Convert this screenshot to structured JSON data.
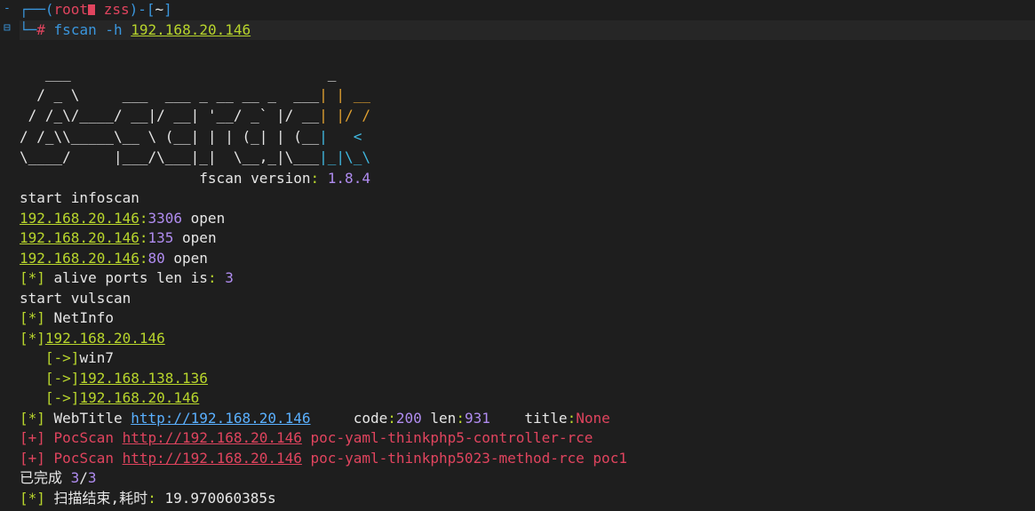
{
  "prompt": {
    "line1_prefix": "┌──(",
    "user": "root",
    "host": "zss",
    "mid": ")-[",
    "cwd": "~",
    "end": "]",
    "line2_prefix": "└─",
    "hash": "#",
    "cmd": "fscan",
    "flag": "-h",
    "target": "192.168.20.146"
  },
  "banner": {
    "l1": "   ___                              _",
    "l2a": "  / _ \\     ___  ___ _ __ __ _  ___",
    "l2b": "| | __",
    "l3a": " / /_\\/____/ __|/ __| '__/ _` |/ __",
    "l3b": "| |/ /",
    "l4a": "/ /_\\\\_____\\__ \\ (__| | | (_| | (__",
    "l4b": "|   <",
    "l5a": "\\____/     |___/\\___|_|  \\__,_|\\___",
    "l5b": "|_|\\_\\",
    "version_label": "                     fscan version",
    "version_colon": ":",
    "version": " 1.8.4"
  },
  "scan": {
    "start_info": "start infoscan",
    "ports": [
      {
        "ip": "192.168.20.146",
        "port": "3306",
        "state": " open"
      },
      {
        "ip": "192.168.20.146",
        "port": "135",
        "state": " open"
      },
      {
        "ip": "192.168.20.146",
        "port": "80",
        "state": " open"
      }
    ],
    "star": "[*]",
    "plus": "[+]",
    "arrow": "   [->]",
    "alive_text": " alive ports len is",
    "alive_colon": ":",
    "alive_count": " 3",
    "start_vul": "start vulscan",
    "netinfo": " NetInfo",
    "net_host": "192.168.20.146",
    "net_name": "win7",
    "net_ip1": "192.168.138.136",
    "net_ip2": "192.168.20.146",
    "webtitle_label": " WebTitle ",
    "webtitle_url": "http://192.168.20.146",
    "code_label": "     code",
    "code_val": "200",
    "len_label": " len",
    "len_val": "931",
    "title_label": "    title",
    "title_val": "None",
    "pocscan_label": " PocScan ",
    "poc1_url": "http://192.168.20.146",
    "poc1_name": " poc-yaml-thinkphp5-controller-rce",
    "poc2_url": "http://192.168.20.146",
    "poc2_name": " poc-yaml-thinkphp5023-method-rce poc1",
    "done_label": "已完成 ",
    "done_cur": "3",
    "done_slash": "/",
    "done_total": "3",
    "finish_text": " 扫描结束,耗时",
    "finish_colon": ":",
    "finish_time": " 19.970060385s"
  },
  "colors": {
    "background": "#1e1e1e",
    "green": "#b8d52c",
    "blue": "#3a96dd",
    "red": "#e0445e",
    "purple": "#b08cf0",
    "link": "#5ab0ff"
  }
}
